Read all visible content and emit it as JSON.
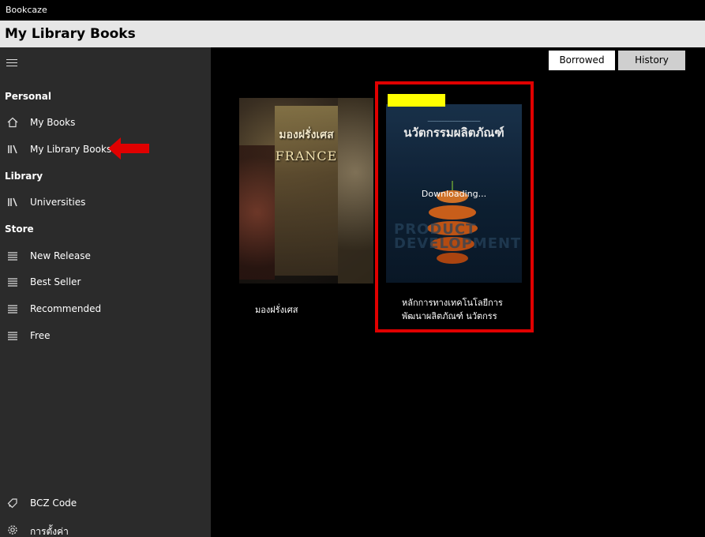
{
  "window": {
    "app_title": "Bookcaze"
  },
  "header": {
    "page_title": "My Library Books"
  },
  "sidebar": {
    "sections": {
      "personal": "Personal",
      "library": "Library",
      "store": "Store"
    },
    "items": [
      {
        "label": "My Books",
        "icon": "home-icon"
      },
      {
        "label": "My Library Books",
        "icon": "library-icon"
      },
      {
        "label": "Universities",
        "icon": "library-icon"
      },
      {
        "label": "New Release",
        "icon": "list-icon"
      },
      {
        "label": "Best Seller",
        "icon": "list-icon"
      },
      {
        "label": "Recommended",
        "icon": "list-icon"
      },
      {
        "label": "Free",
        "icon": "list-icon"
      },
      {
        "label": "BCZ Code",
        "icon": "tag-icon"
      },
      {
        "label": "การตั้งค่า",
        "icon": "gear-icon"
      }
    ]
  },
  "tabs": {
    "borrowed": "Borrowed",
    "history": "History"
  },
  "books": [
    {
      "title": "มองฝรั่งเศส",
      "cover_text_1": "มองฝรั่งเศส",
      "cover_text_2": "FRANCE"
    },
    {
      "title_line1": "หลักการทางเทคโนโลยีการ",
      "title_line2": "พัฒนาผลิตภัณฑ์ นวัตกรร",
      "cover_text": "นวัตกรรมผลิตภัณฑ์",
      "status": "Downloading..."
    }
  ],
  "colors": {
    "accent_red": "#e00000",
    "highlight_yellow": "#ffff00",
    "sidebar_bg": "#2b2b2b"
  }
}
